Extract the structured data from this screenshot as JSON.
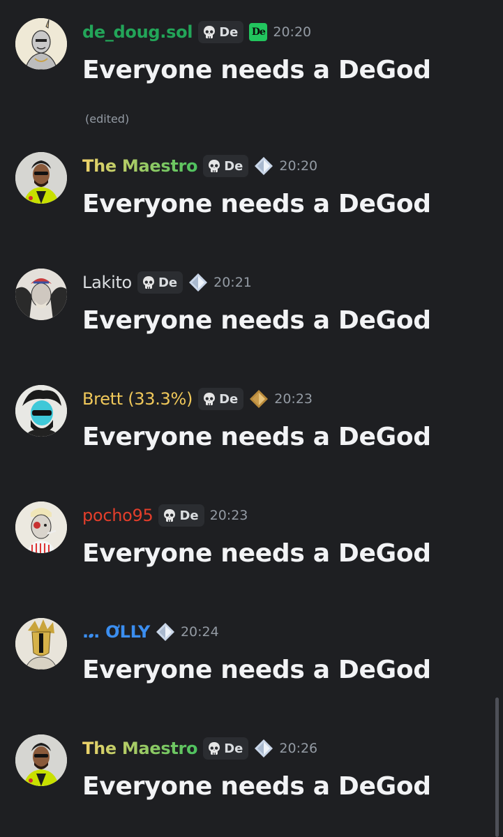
{
  "messages": [
    {
      "username": "de_doug.sol",
      "username_color": "#23a559",
      "role_tag": "De",
      "has_role_tag": true,
      "badge": "de-logo-badge",
      "time": "20:20",
      "text": "Everyone needs a DeGod",
      "edited": "(edited)"
    },
    {
      "username": "The Maestro",
      "username_color": "gradient-yellow-green",
      "role_tag": "De",
      "has_role_tag": true,
      "badge": "diamond-badge",
      "time": "20:20",
      "text": "Everyone needs a DeGod"
    },
    {
      "username": "Lakito",
      "username_color": "#dbdee1",
      "role_tag": "De",
      "has_role_tag": true,
      "badge": "diamond-badge",
      "time": "20:21",
      "text": "Everyone needs a DeGod"
    },
    {
      "username": "Brett (33.3%)",
      "username_color": "#f0c85a",
      "role_tag": "De",
      "has_role_tag": true,
      "badge": "gold-diamond-badge",
      "time": "20:23",
      "text": "Everyone needs a DeGod"
    },
    {
      "username": "pocho95",
      "username_color": "#e33e2b",
      "role_tag": "De",
      "has_role_tag": true,
      "badge": "",
      "time": "20:23",
      "text": "Everyone needs a DeGod"
    },
    {
      "username": ".𝅘. ƠLLY",
      "username_color": "#3b8ef0",
      "has_role_tag": false,
      "badge": "diamond-badge",
      "time": "20:24",
      "text": "Everyone needs a DeGod"
    },
    {
      "username": "The Maestro",
      "username_color": "gradient-yellow-green",
      "role_tag": "De",
      "has_role_tag": true,
      "badge": "diamond-badge",
      "time": "20:26",
      "text": "Everyone needs a DeGod"
    }
  ],
  "role_icon": "skull-icon",
  "colors": {
    "background": "#1e1f22",
    "message_text": "#f2f3f5",
    "timestamp": "#949ba4"
  }
}
